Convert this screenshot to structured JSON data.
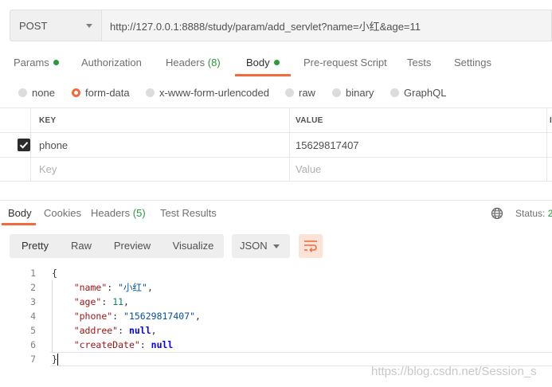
{
  "request": {
    "method": "POST",
    "url": "http://127.0.0.1:8888/study/param/add_servlet?name=小红&age=11"
  },
  "request_tabs": [
    {
      "label": "Params",
      "dot": true
    },
    {
      "label": "Authorization"
    },
    {
      "label": "Headers",
      "count": "(8)"
    },
    {
      "label": "Body",
      "dot": true,
      "active": true
    },
    {
      "label": "Pre-request Script"
    },
    {
      "label": "Tests"
    },
    {
      "label": "Settings"
    }
  ],
  "body_types": [
    {
      "label": "none"
    },
    {
      "label": "form-data",
      "selected": true
    },
    {
      "label": "x-www-form-urlencoded"
    },
    {
      "label": "raw"
    },
    {
      "label": "binary"
    },
    {
      "label": "GraphQL"
    }
  ],
  "kv_table": {
    "headers": {
      "key": "KEY",
      "value": "VALUE",
      "desc": "I"
    },
    "rows": [
      {
        "checked": true,
        "key": "phone",
        "value": "15629817407"
      }
    ],
    "placeholder": {
      "key": "Key",
      "value": "Value"
    }
  },
  "response_tabs": [
    {
      "label": "Body",
      "active": true
    },
    {
      "label": "Cookies"
    },
    {
      "label": "Headers",
      "count": "(5)"
    },
    {
      "label": "Test Results"
    }
  ],
  "status": {
    "label": "Status:",
    "value": "2"
  },
  "view_modes": [
    {
      "label": "Pretty",
      "active": true
    },
    {
      "label": "Raw"
    },
    {
      "label": "Preview"
    },
    {
      "label": "Visualize"
    }
  ],
  "format": "JSON",
  "code_lines": [
    {
      "n": "1",
      "tokens": [
        [
          "punc",
          "{"
        ]
      ]
    },
    {
      "n": "2",
      "tokens": [
        [
          "punc",
          "    "
        ],
        [
          "key",
          "\"name\""
        ],
        [
          "punc",
          ": "
        ],
        [
          "str",
          "\"小红\""
        ],
        [
          "punc",
          ","
        ]
      ]
    },
    {
      "n": "3",
      "tokens": [
        [
          "punc",
          "    "
        ],
        [
          "key",
          "\"age\""
        ],
        [
          "punc",
          ": "
        ],
        [
          "num",
          "11"
        ],
        [
          "punc",
          ","
        ]
      ]
    },
    {
      "n": "4",
      "tokens": [
        [
          "punc",
          "    "
        ],
        [
          "key",
          "\"phone\""
        ],
        [
          "punc",
          ": "
        ],
        [
          "str",
          "\"15629817407\""
        ],
        [
          "punc",
          ","
        ]
      ]
    },
    {
      "n": "5",
      "tokens": [
        [
          "punc",
          "    "
        ],
        [
          "key",
          "\"addree\""
        ],
        [
          "punc",
          ": "
        ],
        [
          "kw",
          "null"
        ],
        [
          "punc",
          ","
        ]
      ]
    },
    {
      "n": "6",
      "tokens": [
        [
          "punc",
          "    "
        ],
        [
          "key",
          "\"createDate\""
        ],
        [
          "punc",
          ": "
        ],
        [
          "kw",
          "null"
        ]
      ]
    },
    {
      "n": "7",
      "tokens": [
        [
          "punc",
          "}"
        ]
      ]
    }
  ],
  "watermark": "https://blog.csdn.net/Session_s",
  "colors": {
    "accent": "#f26b3a",
    "success": "#2a9a3a"
  }
}
